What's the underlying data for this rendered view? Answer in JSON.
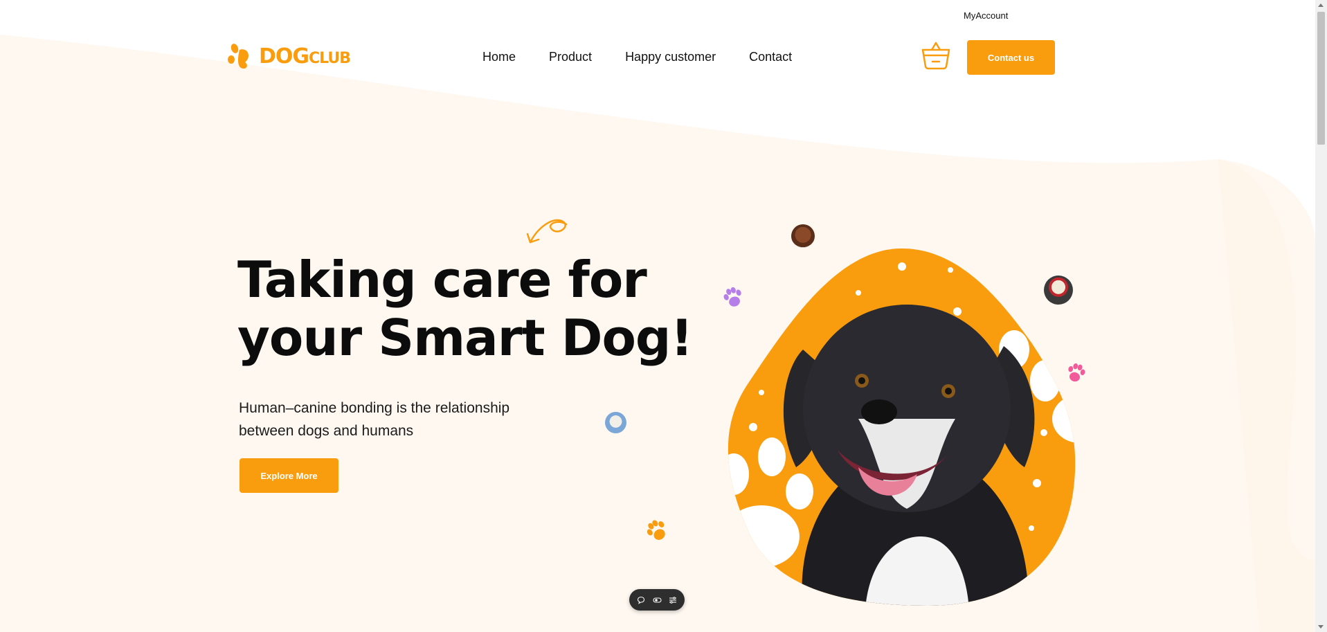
{
  "top_bar": {
    "account_link": "MyAccount"
  },
  "header": {
    "logo": {
      "text_main": "DOG",
      "text_suffix": "CLUB"
    },
    "nav": [
      {
        "label": "Home"
      },
      {
        "label": "Product"
      },
      {
        "label": "Happy customer"
      },
      {
        "label": "Contact"
      }
    ],
    "cart_icon": "basket-icon",
    "contact_button": "Contact us"
  },
  "hero": {
    "title_line1": "Taking care for",
    "title_line2": "your Smart Dog!",
    "subtitle": "Human–canine bonding is the relationship between dogs and humans",
    "cta_button": "Explore More"
  },
  "floating_toolbar": {
    "icons": [
      "chat-icon",
      "toggle-icon",
      "settings-icon"
    ]
  },
  "colors": {
    "accent": "#f99d0f",
    "background_wave": "#fef8f1",
    "text": "#0c0c0c",
    "paw_purple": "#b57ee8",
    "paw_pink": "#f25a9a"
  }
}
